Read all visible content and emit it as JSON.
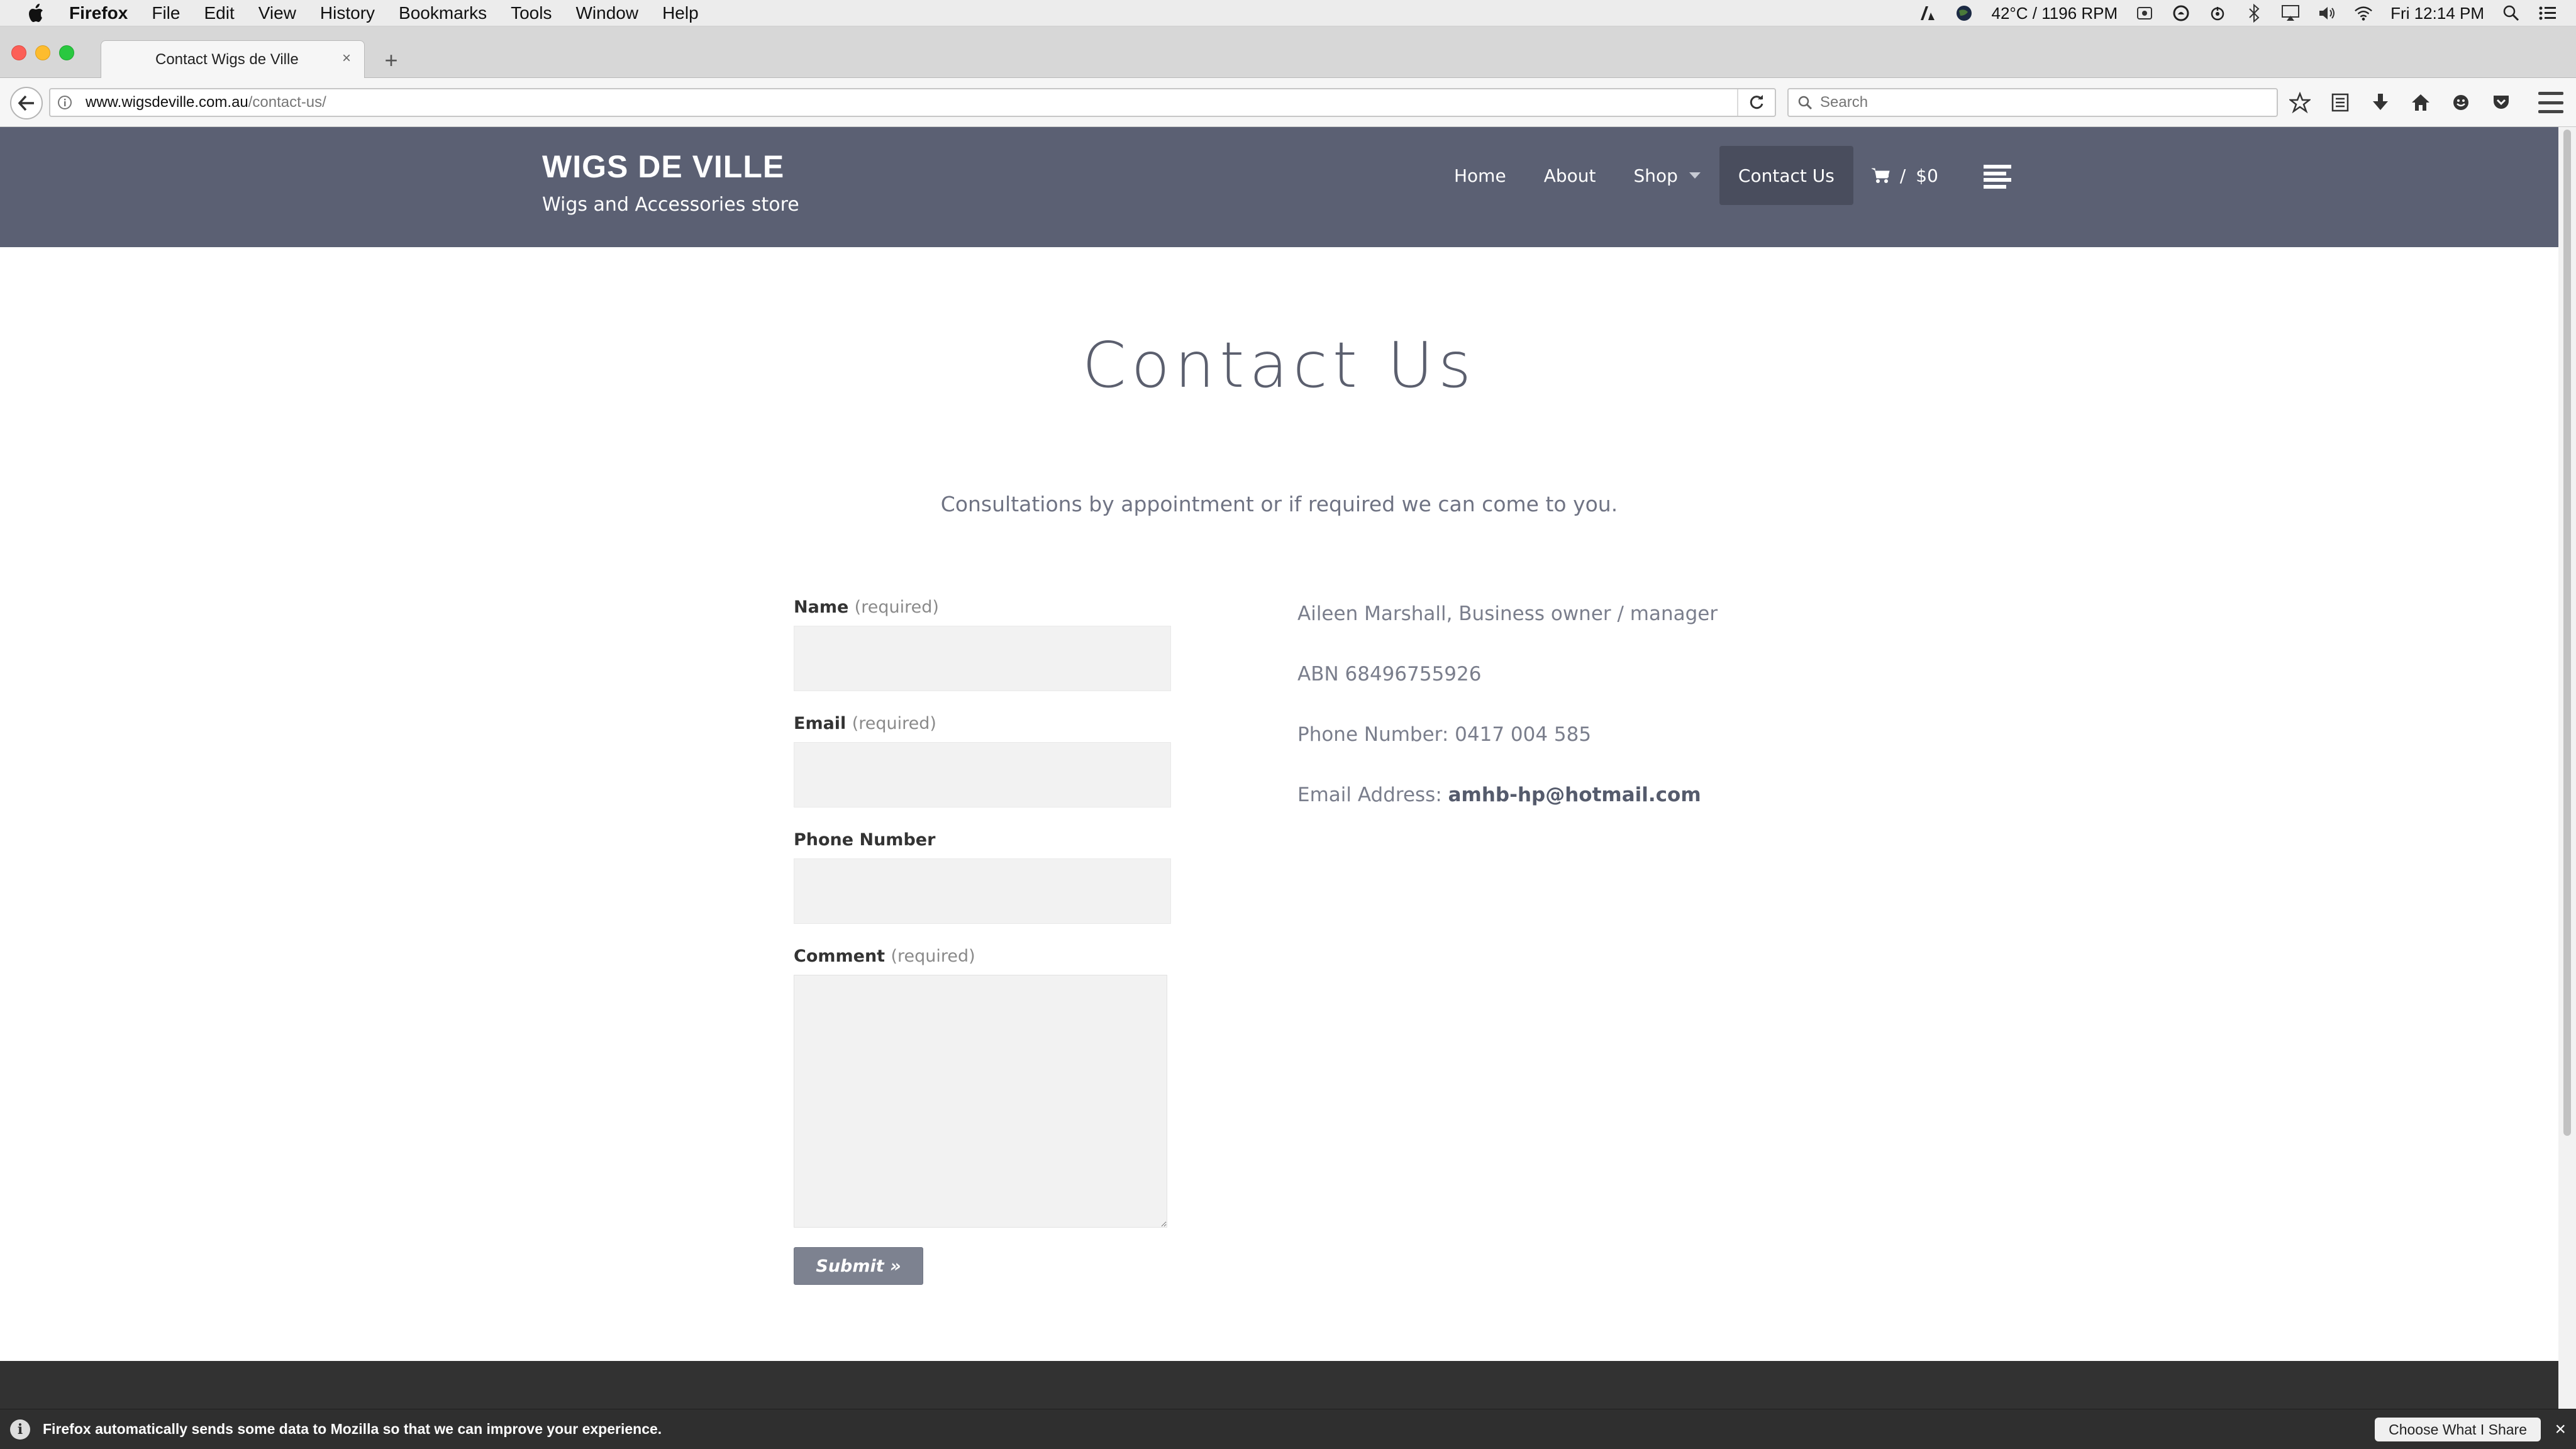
{
  "menubar": {
    "app_name": "Firefox",
    "items": [
      "File",
      "Edit",
      "View",
      "History",
      "Bookmarks",
      "Tools",
      "Window",
      "Help"
    ],
    "status_text": "42°C / 1196 RPM",
    "clock": "Fri 12:14 PM"
  },
  "browser": {
    "tab_title": "Contact Wigs de Ville",
    "url_host": "www.wigsdeville.com.au",
    "url_path": "/contact-us/",
    "search_placeholder": "Search"
  },
  "site": {
    "title": "WIGS DE VILLE",
    "tagline": "Wigs and Accessories store",
    "nav": {
      "home": "Home",
      "about": "About",
      "shop": "Shop",
      "contact": "Contact Us",
      "cart_separator": "/",
      "cart_total": "$0"
    }
  },
  "content": {
    "heading": "Contact Us",
    "intro": "Consultations by appointment or if required we can come to you.",
    "form": {
      "name_label": "Name",
      "email_label": "Email",
      "phone_label": "Phone Number",
      "comment_label": "Comment",
      "required_text": "(required)",
      "submit_label": "Submit »"
    },
    "contact": {
      "owner": "Aileen Marshall, Business owner / manager",
      "abn": "ABN 68496755926",
      "phone": "Phone Number: 0417 004 585",
      "email_prefix": "Email Address: ",
      "email": "amhb-hp@hotmail.com"
    }
  },
  "notice": {
    "message": "Firefox automatically sends some data to Mozilla so that we can improve your experience.",
    "button": "Choose What I Share"
  }
}
